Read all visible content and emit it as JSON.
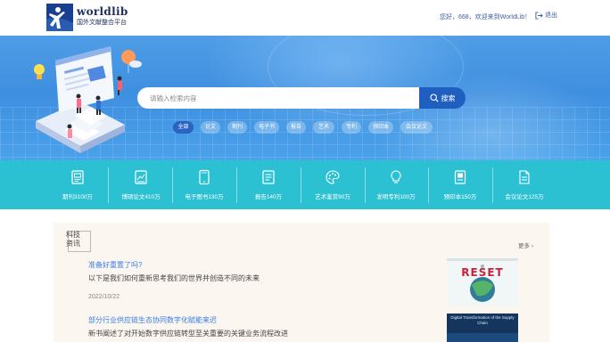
{
  "header": {
    "logo_name": "worldlib",
    "logo_sub": "国外文献整合平台",
    "welcome": "您好，668，欢迎来到WorldLib！",
    "logout": "退出"
  },
  "search": {
    "placeholder": "请输入检索内容",
    "button": "搜索"
  },
  "categories": [
    "全部",
    "论文",
    "期刊",
    "电子书",
    "报告",
    "艺术",
    "专利",
    "预印本",
    "会议论文"
  ],
  "stats": [
    {
      "label": "期刊3100万",
      "icon": "journal-icon"
    },
    {
      "label": "博硕论文410万",
      "icon": "thesis-icon"
    },
    {
      "label": "电子图书130万",
      "icon": "tablet-icon"
    },
    {
      "label": "报告140万",
      "icon": "report-icon"
    },
    {
      "label": "艺术鉴赏90万",
      "icon": "palette-icon"
    },
    {
      "label": "发明专利100万",
      "icon": "lightbulb-icon"
    },
    {
      "label": "预印本150万",
      "icon": "preprint-icon"
    },
    {
      "label": "会议论文125万",
      "icon": "conference-icon"
    }
  ],
  "news": {
    "badge_line1": "科技",
    "badge_line2": "资讯",
    "more": "更多",
    "items": [
      {
        "title": "准备好重置了吗?",
        "subtitle": "以下是我们如何重新思考我们的世界并创造不同的未来",
        "date": "2022/10/22",
        "cover_title": "RESET"
      },
      {
        "title": "部分行业供应链生态协同数字化赋能来迟",
        "subtitle": "新书阐述了对开始数字供应链转型至关重要的关键业务流程改进",
        "date": "",
        "cover_title": "Digital Transformation of the Supply Chain"
      }
    ]
  },
  "colors": {
    "banner": "#4a9ae5",
    "stats_band": "#2cc1d2",
    "search_button": "#1f5fbf",
    "link": "#3a7ee0",
    "news_bg": "#fcf6f0"
  }
}
